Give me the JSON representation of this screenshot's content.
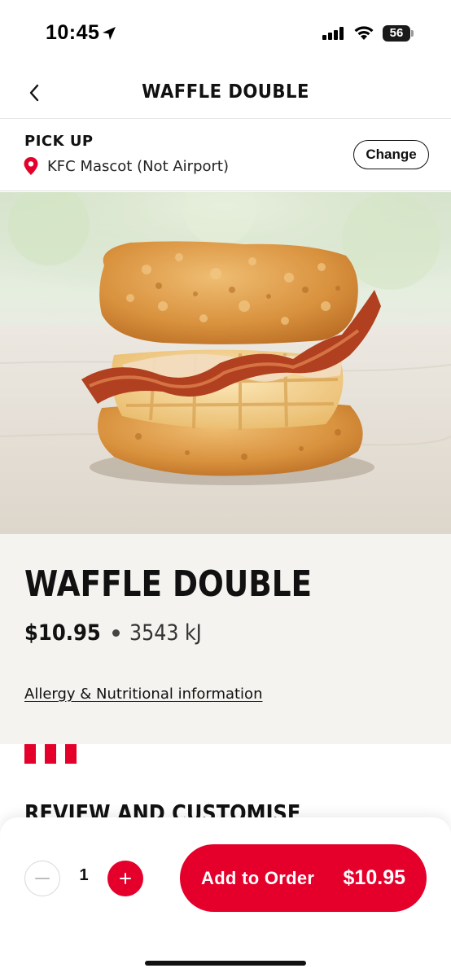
{
  "status_bar": {
    "time": "10:45",
    "battery": "56"
  },
  "header": {
    "title": "WAFFLE DOUBLE",
    "back_icon": "chevron-left-icon"
  },
  "pickup": {
    "label": "PICK UP",
    "store": "KFC Mascot (Not Airport)",
    "change_label": "Change",
    "pin_color": "#e4002b"
  },
  "product": {
    "name": "WAFFLE DOUBLE",
    "price": "$10.95",
    "energy": "3543 kJ",
    "allergy_link": "Allergy & Nutritional information"
  },
  "section": {
    "review_heading": "REVIEW AND CUSTOMISE"
  },
  "order_bar": {
    "quantity": "1",
    "add_label": "Add to Order",
    "total": "$10.95"
  },
  "colors": {
    "brand_red": "#e4002b",
    "info_bg": "#f4f3f0"
  }
}
